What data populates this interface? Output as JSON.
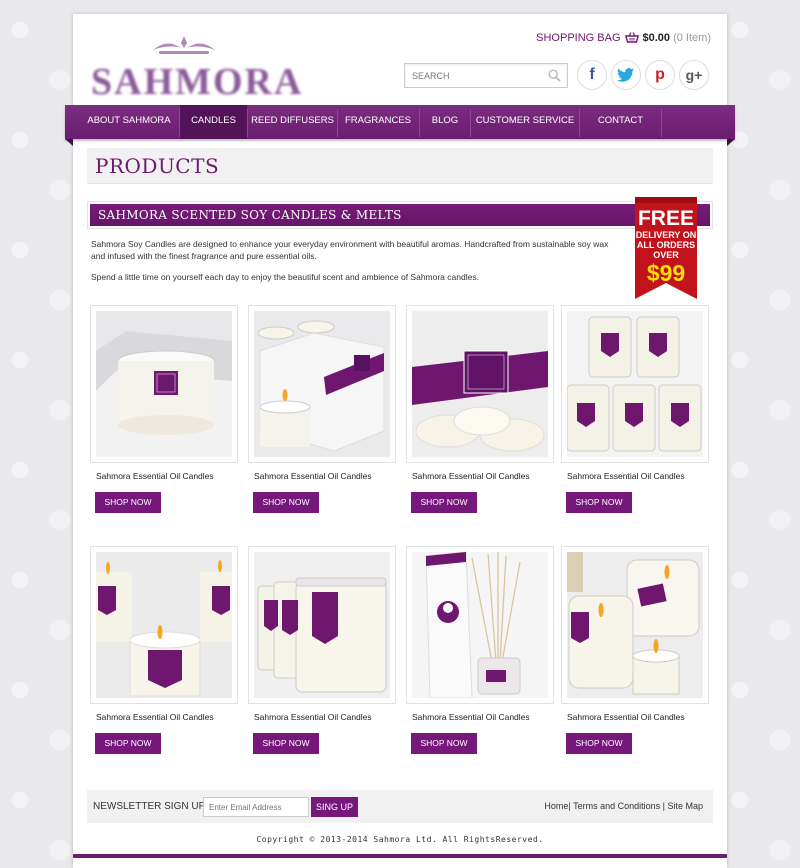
{
  "brand": {
    "name": "SAHMORA"
  },
  "cart": {
    "label": "SHOPPING BAG",
    "amount": "$0.00",
    "items": "(0 Item)"
  },
  "search": {
    "placeholder": "SEARCH"
  },
  "social": [
    "f",
    "t",
    "p",
    "g+"
  ],
  "nav": [
    "ABOUT SAHMORA",
    "CANDLES",
    "REED DIFFUSERS",
    "FRAGRANCES",
    "BLOG",
    "CUSTOMER SERVICE",
    "CONTACT"
  ],
  "active_nav": "CANDLES",
  "page": {
    "title": "PRODUCTS",
    "section": "SAHMORA SCENTED SOY CANDLES & MELTS",
    "intro1": "Sahmora Soy Candles are designed to enhance your everyday environment with beautiful aromas.  Handcrafted from sustainable soy wax and infused with the finest fragrance and pure essential oils.",
    "intro2": "Spend a little time on yourself each day to enjoy the beautiful scent and ambience of Sahmora candles."
  },
  "promo": {
    "line1": "FREE",
    "line2": "DELIVERY ON",
    "line3": "ALL ORDERS",
    "line4": "OVER",
    "line5": "$99"
  },
  "products": [
    {
      "name": "Sahmora Essential Oil Candles",
      "button": "SHOP NOW"
    },
    {
      "name": "Sahmora Essential Oil Candles",
      "button": "SHOP NOW"
    },
    {
      "name": "Sahmora Essential Oil Candles",
      "button": "SHOP NOW"
    },
    {
      "name": "Sahmora Essential Oil Candles",
      "button": "SHOP NOW"
    },
    {
      "name": "Sahmora Essential Oil Candles",
      "button": "SHOP NOW"
    },
    {
      "name": "Sahmora Essential Oil Candles",
      "button": "SHOP NOW"
    },
    {
      "name": "Sahmora Essential Oil Candles",
      "button": "SHOP NOW"
    },
    {
      "name": "Sahmora Essential Oil Candles",
      "button": "SHOP NOW"
    }
  ],
  "newsletter": {
    "label": "NEWSLETTER SIGN UP",
    "placeholder": "Enter Email Address",
    "button": "SING UP"
  },
  "footer": {
    "links": [
      "Home",
      "Terms and Conditions",
      "Site Map"
    ],
    "copyright": "Copyright © 2013-2014 Sahmora Ltd. All RightsReserved."
  },
  "colors": {
    "brand_purple": "#6f176f",
    "promo_red": "#c2121c",
    "promo_yellow": "#ffe000"
  }
}
